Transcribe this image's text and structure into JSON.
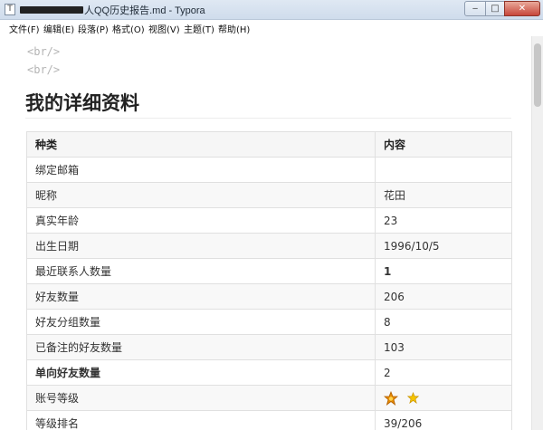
{
  "window": {
    "title_visible": "人QQ历史报告.md - Typora",
    "controls": {
      "minimize": "‒",
      "maximize": "□",
      "close": "✕"
    }
  },
  "menu": [
    "文件(F)",
    "编辑(E)",
    "段落(P)",
    "格式(O)",
    "视图(V)",
    "主题(T)",
    "帮助(H)"
  ],
  "document": {
    "br_lines": [
      "<br/>",
      "<br/>"
    ],
    "heading": "我的详细资料",
    "table": {
      "headers": [
        "种类",
        "内容"
      ],
      "rows": [
        {
          "key": "绑定邮箱",
          "value": ""
        },
        {
          "key": "昵称",
          "value": "花田"
        },
        {
          "key": "真实年龄",
          "value": "23"
        },
        {
          "key": "出生日期",
          "value": "1996/10/5"
        },
        {
          "key": "最近联系人数量",
          "value": "1"
        },
        {
          "key": "好友数量",
          "value": "206"
        },
        {
          "key": "好友分组数量",
          "value": "8"
        },
        {
          "key": "已备注的好友数量",
          "value": "103"
        },
        {
          "key": "单向好友数量",
          "value": "2"
        },
        {
          "key": "账号等级",
          "value": "",
          "icons": [
            "crown-icon",
            "star-icon"
          ]
        },
        {
          "key": "等级排名",
          "value": "39/206"
        }
      ]
    }
  },
  "colors": {
    "accent_star": "#f5b800",
    "crown": "#e58a00"
  }
}
